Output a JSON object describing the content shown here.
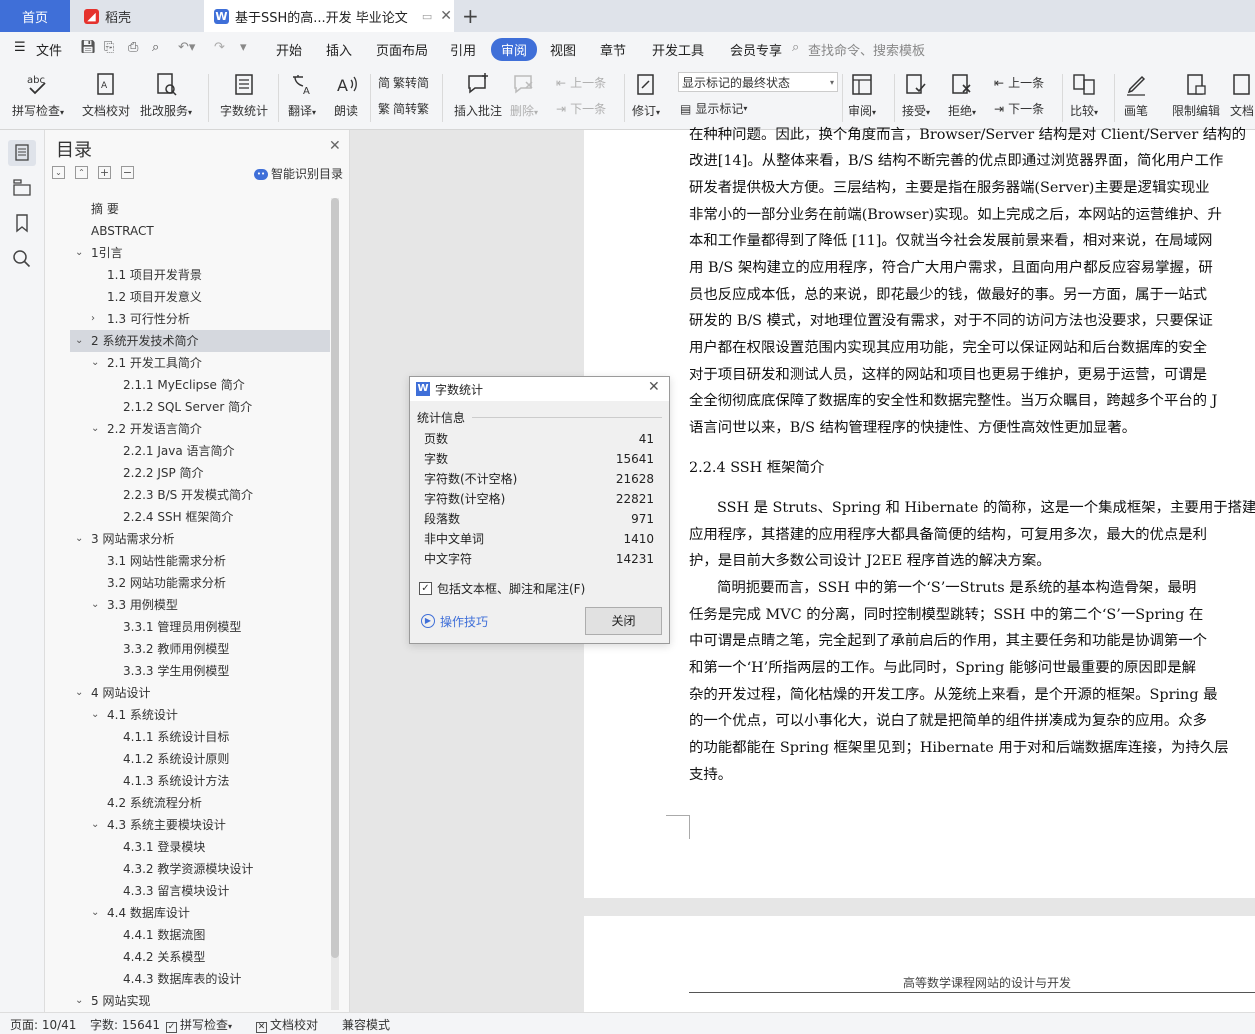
{
  "tabs": {
    "home": "首页",
    "daoke": "稻壳",
    "doc": "基于SSH的高...开发 毕业论文",
    "new": "+"
  },
  "menu": {
    "file": "文件",
    "items": [
      "开始",
      "插入",
      "页面布局",
      "引用",
      "审阅",
      "视图",
      "章节",
      "开发工具",
      "会员专享"
    ],
    "search": "查找命令、搜索模板"
  },
  "ribbon": {
    "spell": "拼写检查",
    "doccheck": "文档校对",
    "annotate": "批改服务",
    "wordcount": "字数统计",
    "translate": "翻译",
    "read": "朗读",
    "trad": "繁转简",
    "simp": "简转繁",
    "insert_comment": "插入批注",
    "delete": "删除",
    "prev_dis": "上一条",
    "next_dis": "下一条",
    "revise": "修订",
    "markup_state": "显示标记的最终状态",
    "show_markup": "显示标记",
    "review": "审阅",
    "accept": "接受",
    "reject": "拒绝",
    "prev": "上一条",
    "next": "下一条",
    "compare": "比较",
    "pen": "画笔",
    "restrict": "限制编辑",
    "doc": "文档"
  },
  "nav": {
    "title": "目录",
    "smart": "智能识别目录",
    "items": [
      "摘  要",
      "ABSTRACT",
      "1引言",
      "1.1  项目开发背景",
      "1.2  项目开发意义",
      "1.3 可行性分析",
      "2  系统开发技术简介",
      "2.1 开发工具简介",
      "2.1.1 MyEclipse 简介",
      "2.1.2 SQL Server 简介",
      "2.2  开发语言简介",
      "2.2.1 Java 语言简介",
      "2.2.2 JSP 简介",
      "2.2.3 B/S 开发模式简介",
      "2.2.4 SSH 框架简介",
      "3  网站需求分析",
      "3.1  网站性能需求分析",
      "3.2  网站功能需求分析",
      "3.3  用例模型",
      "3.3.1  管理员用例模型",
      "3.3.2  教师用例模型",
      "3.3.3  学生用例模型",
      "4  网站设计",
      "4.1  系统设计",
      "4.1.1  系统设计目标",
      "4.1.2  系统设计原则",
      "4.1.3  系统设计方法",
      "4.2  系统流程分析",
      "4.3  系统主要模块设计",
      "4.3.1  登录模块",
      "4.3.2  教学资源模块设计",
      "4.3.3  留言模块设计",
      "4.4  数据库设计",
      "4.4.1  数据流图",
      "4.4.2  关系模型",
      "4.4.3  数据库表的设计",
      "5  网站实现"
    ]
  },
  "doc": {
    "lines1": [
      "在种种问题。因此，换个角度而言，Browser/Server 结构是对 Client/Server 结构的",
      "改进[14]。从整体来看，B/S 结构不断完善的优点即通过浏览器界面，简化用户工作",
      "研发者提供极大方便。三层结构，主要是指在服务器端(Server)主要是逻辑实现业",
      "非常小的一部分业务在前端(Browser)实现。如上完成之后，本网站的运营维护、升",
      "本和工作量都得到了降低 [11]。仅就当今社会发展前景来看，相对来说，在局域网",
      "用 B/S 架构建立的应用程序，符合广大用户需求，且面向用户都反应容易掌握，研",
      "员也反应成本低，总的来说，即花最少的钱，做最好的事。另一方面，属于一站式",
      "研发的 B/S 模式，对地理位置没有需求，对于不同的访问方法也没要求，只要保证",
      "用户都在权限设置范围内实现其应用功能，完全可以保证网站和后台数据库的安全",
      "对于项目研发和测试人员，这样的网站和项目也更易于维护，更易于运营，可谓是",
      "全全彻彻底底保障了数据库的安全性和数据完整性。当万众瞩目，跨越多个平台的 J",
      "语言问世以来，B/S 结构管理程序的快捷性、方便性高效性更加显著。"
    ],
    "heading": "2.2.4 SSH 框架简介",
    "lines2": [
      "SSH 是 Struts、Spring 和 Hibernate 的简称，这是一个集成框架，主要用于搭建",
      "应用程序，其搭建的应用程序大都具备简便的结构，可复用多次，最大的优点是利",
      "护，是目前大多数公司设计 J2EE 程序首选的解决方案。",
      "简明扼要而言，SSH 中的第一个‘S’一Struts 是系统的基本构造骨架，最明",
      "任务是完成 MVC 的分离，同时控制模型跳转；SSH 中的第二个‘S’一Spring 在",
      "中可谓是点睛之笔，完全起到了承前启后的作用，其主要任务和功能是协调第一个",
      "和第一个‘H’所指两层的工作。与此同时，Spring 能够问世最重要的原因即是解",
      "杂的开发过程，简化枯燥的开发工序。从笼统上来看，是个开源的框架。Spring 最",
      "的一个优点，可以小事化大，说白了就是把简单的组件拼凑成为复杂的应用。众多",
      "的功能都能在 Spring 框架里见到；Hibernate 用于对和后端数据库连接，为持久层",
      "支持。"
    ],
    "page2_header": "高等数学课程网站的设计与开发"
  },
  "dialog": {
    "title": "字数统计",
    "section": "统计信息",
    "rows": [
      {
        "label": "页数",
        "value": "41"
      },
      {
        "label": "字数",
        "value": "15641"
      },
      {
        "label": "字符数(不计空格)",
        "value": "21628"
      },
      {
        "label": "字符数(计空格)",
        "value": "22821"
      },
      {
        "label": "段落数",
        "value": "971"
      },
      {
        "label": "非中文单词",
        "value": "1410"
      },
      {
        "label": "中文字符",
        "value": "14231"
      }
    ],
    "checkbox": "包括文本框、脚注和尾注(F)",
    "tips": "操作技巧",
    "close": "关闭"
  },
  "status": {
    "page": "页面: 10/41",
    "words": "字数: 15641",
    "spell": "拼写检查",
    "doccheck": "文档校对",
    "compat": "兼容模式"
  },
  "colors": {
    "accent": "#3f6fd8",
    "wps_red": "#e5322d"
  }
}
